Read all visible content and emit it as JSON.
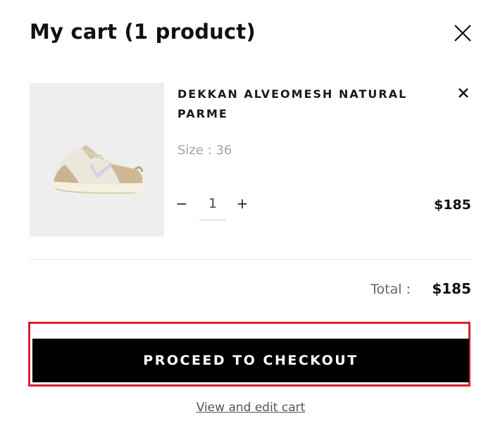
{
  "cart": {
    "title": "My cart (1 product)",
    "close_icon": "close-icon"
  },
  "item": {
    "name": "DEKKAN ALVEOMESH NATURAL PARME",
    "size_text": "Size : 36",
    "quantity": "1",
    "minus_label": "−",
    "plus_label": "+",
    "price": "$185",
    "remove_icon": "close-icon",
    "image": "sneaker-image"
  },
  "summary": {
    "total_label": "Total :",
    "total_value": "$185"
  },
  "actions": {
    "checkout_label": "PROCEED TO CHECKOUT",
    "view_edit_label": "View and edit cart"
  },
  "colors": {
    "button_bg": "#000000",
    "highlight": "#d8202a",
    "muted_text": "#a5a5a5"
  }
}
